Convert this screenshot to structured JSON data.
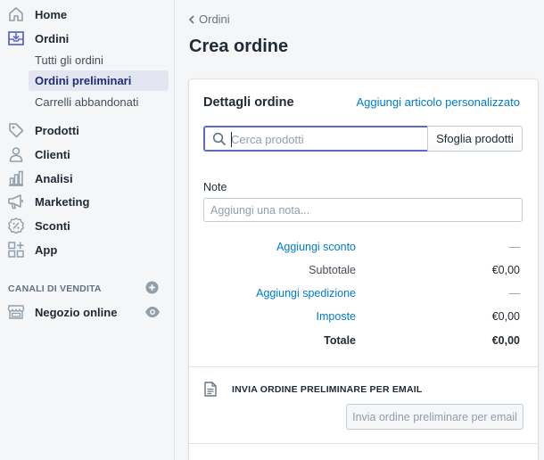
{
  "sidebar": {
    "items": [
      {
        "label": "Home",
        "icon": "home-icon"
      },
      {
        "label": "Ordini",
        "icon": "orders-icon"
      },
      {
        "label": "Prodotti",
        "icon": "tag-icon"
      },
      {
        "label": "Clienti",
        "icon": "person-icon"
      },
      {
        "label": "Analisi",
        "icon": "bar-chart-icon"
      },
      {
        "label": "Marketing",
        "icon": "megaphone-icon"
      },
      {
        "label": "Sconti",
        "icon": "discount-icon"
      },
      {
        "label": "App",
        "icon": "apps-icon"
      }
    ],
    "orders_sub": [
      {
        "label": "Tutti gli ordini"
      },
      {
        "label": "Ordini preliminari",
        "active": true
      },
      {
        "label": "Carrelli abbandonati"
      }
    ],
    "channels_title": "CANALI DI VENDITA",
    "channel": {
      "label": "Negozio online",
      "icon": "store-icon"
    }
  },
  "header": {
    "breadcrumb": "Ordini",
    "title": "Crea ordine"
  },
  "order_card": {
    "title": "Dettagli ordine",
    "custom_item_link": "Aggiungi articolo personalizzato",
    "search_placeholder": "Cerca prodotti",
    "browse_button": "Sfoglia prodotti",
    "note_label": "Note",
    "note_placeholder": "Aggiungi una nota...",
    "summary": {
      "discount_label": "Aggiungi sconto",
      "discount_value": "—",
      "subtotal_label": "Subtotale",
      "subtotal_value": "€0,00",
      "shipping_label": "Aggiungi spedizione",
      "shipping_value": "—",
      "taxes_label": "Imposte",
      "taxes_value": "€0,00",
      "total_label": "Totale",
      "total_value": "€0,00"
    },
    "email_section_title": "INVIA ORDINE PRELIMINARE PER EMAIL",
    "email_button": "Invia ordine preliminare per email"
  },
  "colors": {
    "accent": "#5c6ac4",
    "link": "#007ace",
    "active_nav_bg": "#e3e6f0",
    "active_nav_text": "#202e78"
  }
}
